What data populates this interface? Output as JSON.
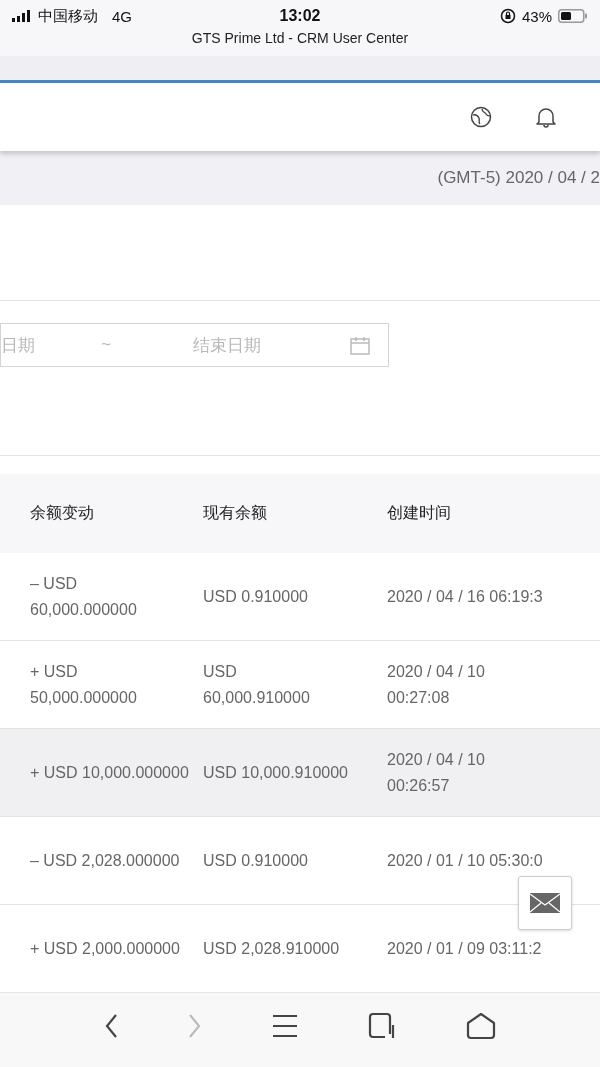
{
  "status_bar": {
    "carrier": "中国移动",
    "network": "4G",
    "time": "13:02",
    "battery": "43%"
  },
  "page_title": "GTS Prime Ltd - CRM User Center",
  "timezone_date": "(GMT-5) 2020 / 04 / 2",
  "date_range": {
    "start_placeholder": "日期",
    "separator": "~",
    "end_placeholder": "结束日期"
  },
  "table": {
    "columns": [
      "余额变动",
      "现有余额",
      "创建时间"
    ],
    "rows": [
      {
        "hovered": false,
        "cells": [
          "– USD\n60,000.000000",
          "USD 0.910000",
          "2020 / 04 / 16 06:19:3"
        ]
      },
      {
        "hovered": false,
        "cells": [
          "+ USD\n50,000.000000",
          "USD\n60,000.910000",
          "2020 / 04 / 10\n00:27:08"
        ]
      },
      {
        "hovered": true,
        "cells": [
          "+ USD 10,000.000000",
          "USD 10,000.910000",
          "2020 / 04 / 10\n00:26:57"
        ]
      },
      {
        "hovered": false,
        "cells": [
          "– USD 2,028.000000",
          "USD 0.910000",
          "2020 / 01 / 10 05:30:0"
        ]
      },
      {
        "hovered": false,
        "cells": [
          "+ USD 2,000.000000",
          "USD 2,028.910000",
          "2020 / 01 / 09 03:11:2"
        ]
      }
    ]
  },
  "browser_toolbar": {
    "back_disabled": false,
    "forward_disabled": true
  }
}
